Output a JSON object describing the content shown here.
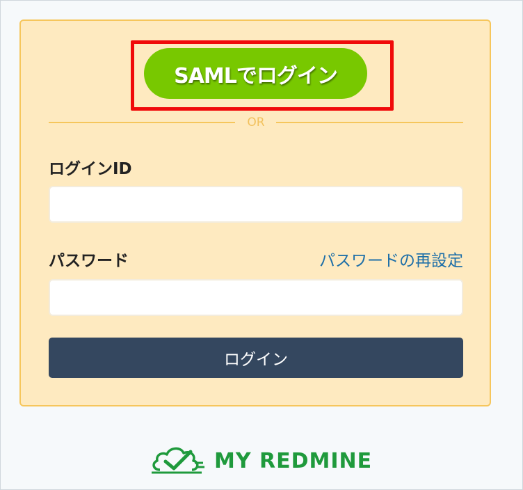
{
  "login_form": {
    "saml_button_label": "SAMLでログイン",
    "divider_text": "OR",
    "login_id_label": "ログインID",
    "login_id_value": "",
    "password_label": "パスワード",
    "password_value": "",
    "reset_password_link": "パスワードの再設定",
    "login_button_label": "ログイン"
  },
  "brand": {
    "logo_text": "MY REDMINE",
    "logo_icon": "cloud-check-icon",
    "logo_color": "#1f9a3c"
  },
  "colors": {
    "card_background": "#feeac0",
    "card_border": "#f6c65c",
    "saml_button": "#78c800",
    "login_button": "#34475f",
    "link": "#1e6fa8",
    "highlight_border": "#f00a0a"
  },
  "icons": {
    "logo": "cloud-check-icon"
  }
}
